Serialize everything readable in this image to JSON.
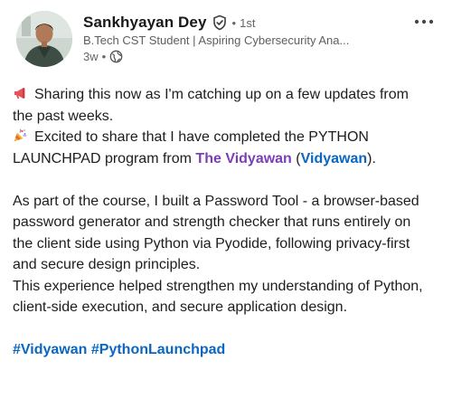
{
  "post": {
    "author": {
      "name": "Sankhyayan Dey",
      "degree": "1st",
      "headline": "B.Tech CST Student | Aspiring Cybersecurity Ana...",
      "time": "3w",
      "separator": "•",
      "avatar_icon": "profile-photo"
    },
    "icons": {
      "verified": "verified-shield-icon",
      "visibility": "globe-icon",
      "more": "more-options-icon",
      "megaphone": "megaphone-emoji",
      "party": "party-popper-emoji"
    },
    "body": {
      "line1": "Sharing this now as I'm catching up on a few updates from the past weeks.",
      "line2_prefix": "Excited to share that I have completed the PYTHON LAUNCHPAD program from ",
      "mention_org": "The Vidyawan",
      "paren_open": " (",
      "mention_page": "Vidyawan",
      "paren_close": ").",
      "para2": "As part of the course, I built a Password Tool - a browser-based password generator and strength checker that runs entirely on the client side using Python via Pyodide, following privacy-first and secure design principles.",
      "para3": "This experience helped strengthen my understanding of Python, client-side execution, and secure application design."
    },
    "hashtags": [
      "#Vidyawan",
      "#PythonLaunchpad"
    ],
    "hashtag_separator": " "
  },
  "colors": {
    "mention_purple": "#7a3fb8",
    "link_blue": "#0a66c2",
    "muted_text": "#666666"
  }
}
